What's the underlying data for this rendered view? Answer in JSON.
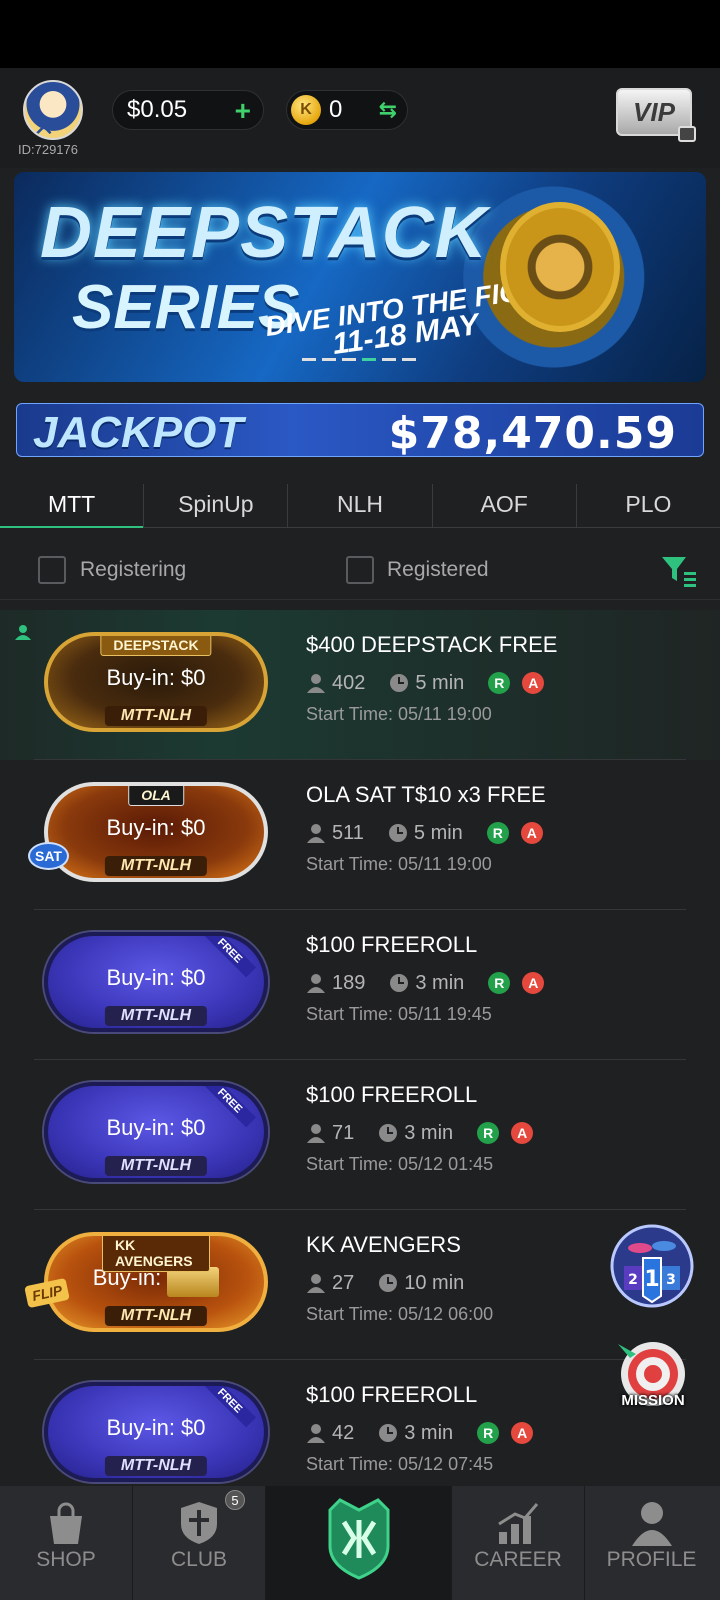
{
  "header": {
    "user_id": "ID:729176",
    "cash": "$0.05",
    "coins": "0",
    "coin_symbol": "K",
    "vip_label": "VIP"
  },
  "banner": {
    "title": "DEEPSTACK",
    "subtitle": "SERIES",
    "tagline": "DIVE INTO THE FIGHT!",
    "dates": "11-18 MAY",
    "slide_count": 6,
    "active_slide": 4
  },
  "jackpot": {
    "label": "JACKPOT",
    "amount": "$78,470.59"
  },
  "tabs": [
    {
      "label": "MTT",
      "active": true
    },
    {
      "label": "SpinUp",
      "active": false
    },
    {
      "label": "NLH",
      "active": false
    },
    {
      "label": "AOF",
      "active": false
    },
    {
      "label": "PLO",
      "active": false
    }
  ],
  "filters": {
    "registering": "Registering",
    "registered": "Registered"
  },
  "tournaments": [
    {
      "name": "$400 DEEPSTACK FREE",
      "players": "402",
      "duration": "5 min",
      "badges": [
        "R",
        "A"
      ],
      "start": "Start Time: 05/11 19:00",
      "buyin": "Buy-in: $0",
      "type": "MTT-NLH",
      "card_badge": "DEEPSTACK",
      "style": "gold"
    },
    {
      "name": "OLA SAT T$10 x3 FREE",
      "players": "511",
      "duration": "5 min",
      "badges": [
        "R",
        "A"
      ],
      "start": "Start Time: 05/11 19:00",
      "buyin": "Buy-in: $0",
      "type": "MTT-NLH",
      "card_badge": "OLA",
      "side_badge": "SAT",
      "style": "ola"
    },
    {
      "name": "$100 FREEROLL",
      "players": "189",
      "duration": "3 min",
      "badges": [
        "R",
        "A"
      ],
      "start": "Start Time: 05/11 19:45",
      "buyin": "Buy-in: $0",
      "type": "MTT-NLH",
      "ribbon": "FREE",
      "style": "purple"
    },
    {
      "name": "$100 FREEROLL",
      "players": "71",
      "duration": "3 min",
      "badges": [
        "R",
        "A"
      ],
      "start": "Start Time: 05/12 01:45",
      "buyin": "Buy-in: $0",
      "type": "MTT-NLH",
      "ribbon": "FREE",
      "style": "purple"
    },
    {
      "name": "KK AVENGERS",
      "players": "27",
      "duration": "10 min",
      "badges": [],
      "start": "Start Time: 05/12 06:00",
      "buyin": "Buy-in:",
      "type": "MTT-NLH",
      "card_badge": "KK AVENGERS",
      "side_badge": "FLIP",
      "style": "kk"
    },
    {
      "name": "$100 FREEROLL",
      "players": "42",
      "duration": "3 min",
      "badges": [
        "R",
        "A"
      ],
      "start": "Start Time: 05/12 07:45",
      "buyin": "Buy-in: $0",
      "type": "MTT-NLH",
      "ribbon": "FREE",
      "style": "purple"
    }
  ],
  "floating": {
    "mission_label": "MISSION"
  },
  "nav": [
    {
      "label": "SHOP",
      "icon": "shop-bag-icon"
    },
    {
      "label": "CLUB",
      "icon": "club-shield-icon",
      "badge": "5"
    },
    {
      "label": "",
      "icon": "home-crest-icon"
    },
    {
      "label": "CAREER",
      "icon": "career-chart-icon"
    },
    {
      "label": "PROFILE",
      "icon": "profile-person-icon"
    }
  ],
  "colors": {
    "accent": "#2ec27e",
    "bg": "#1f2022",
    "badge_r": "#22a04a",
    "badge_a": "#e5483c"
  }
}
